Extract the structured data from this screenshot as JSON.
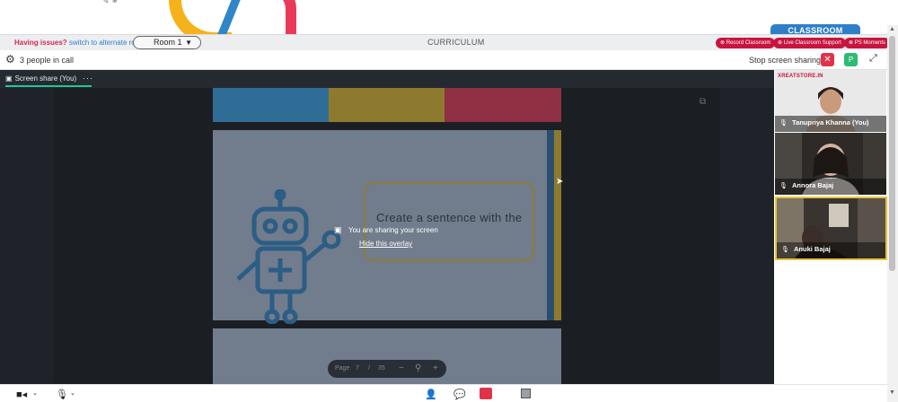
{
  "header": {
    "brand_badge": "CLASSROOM",
    "issues_text": "Having issues?",
    "alternate_link": "switch to alternate room",
    "room_selected": "Room 1",
    "curriculum_label": "CURRICULUM",
    "actions": [
      "Record Classroom",
      "Live Classroom Support",
      "PS Moments"
    ]
  },
  "callbar": {
    "people_count": "3 people in call",
    "stop_sharing": "Stop screen sharing",
    "close_symbol": "✕",
    "avatar_initial": "P"
  },
  "stage": {
    "tab_label": "Screen share (You)",
    "tab_more": "···",
    "overlay_title": "You are sharing your screen",
    "overlay_link": "Hide this overlay",
    "slide_text": "Create a sentence with the",
    "pager": {
      "label": "Page",
      "current": "7",
      "separator": "/",
      "total": "35"
    },
    "colors": {
      "blue": "#2f6d96",
      "gold": "#8e7a2f",
      "red": "#8e2f44",
      "slide_bg": "#717c8c"
    }
  },
  "participants": {
    "brand_logo": "XREATSTORE.IN",
    "items": [
      {
        "name": "Tanupriya Khanna (You)"
      },
      {
        "name": "Annora Bajaj"
      },
      {
        "name": "Anuki Bajaj"
      }
    ]
  }
}
